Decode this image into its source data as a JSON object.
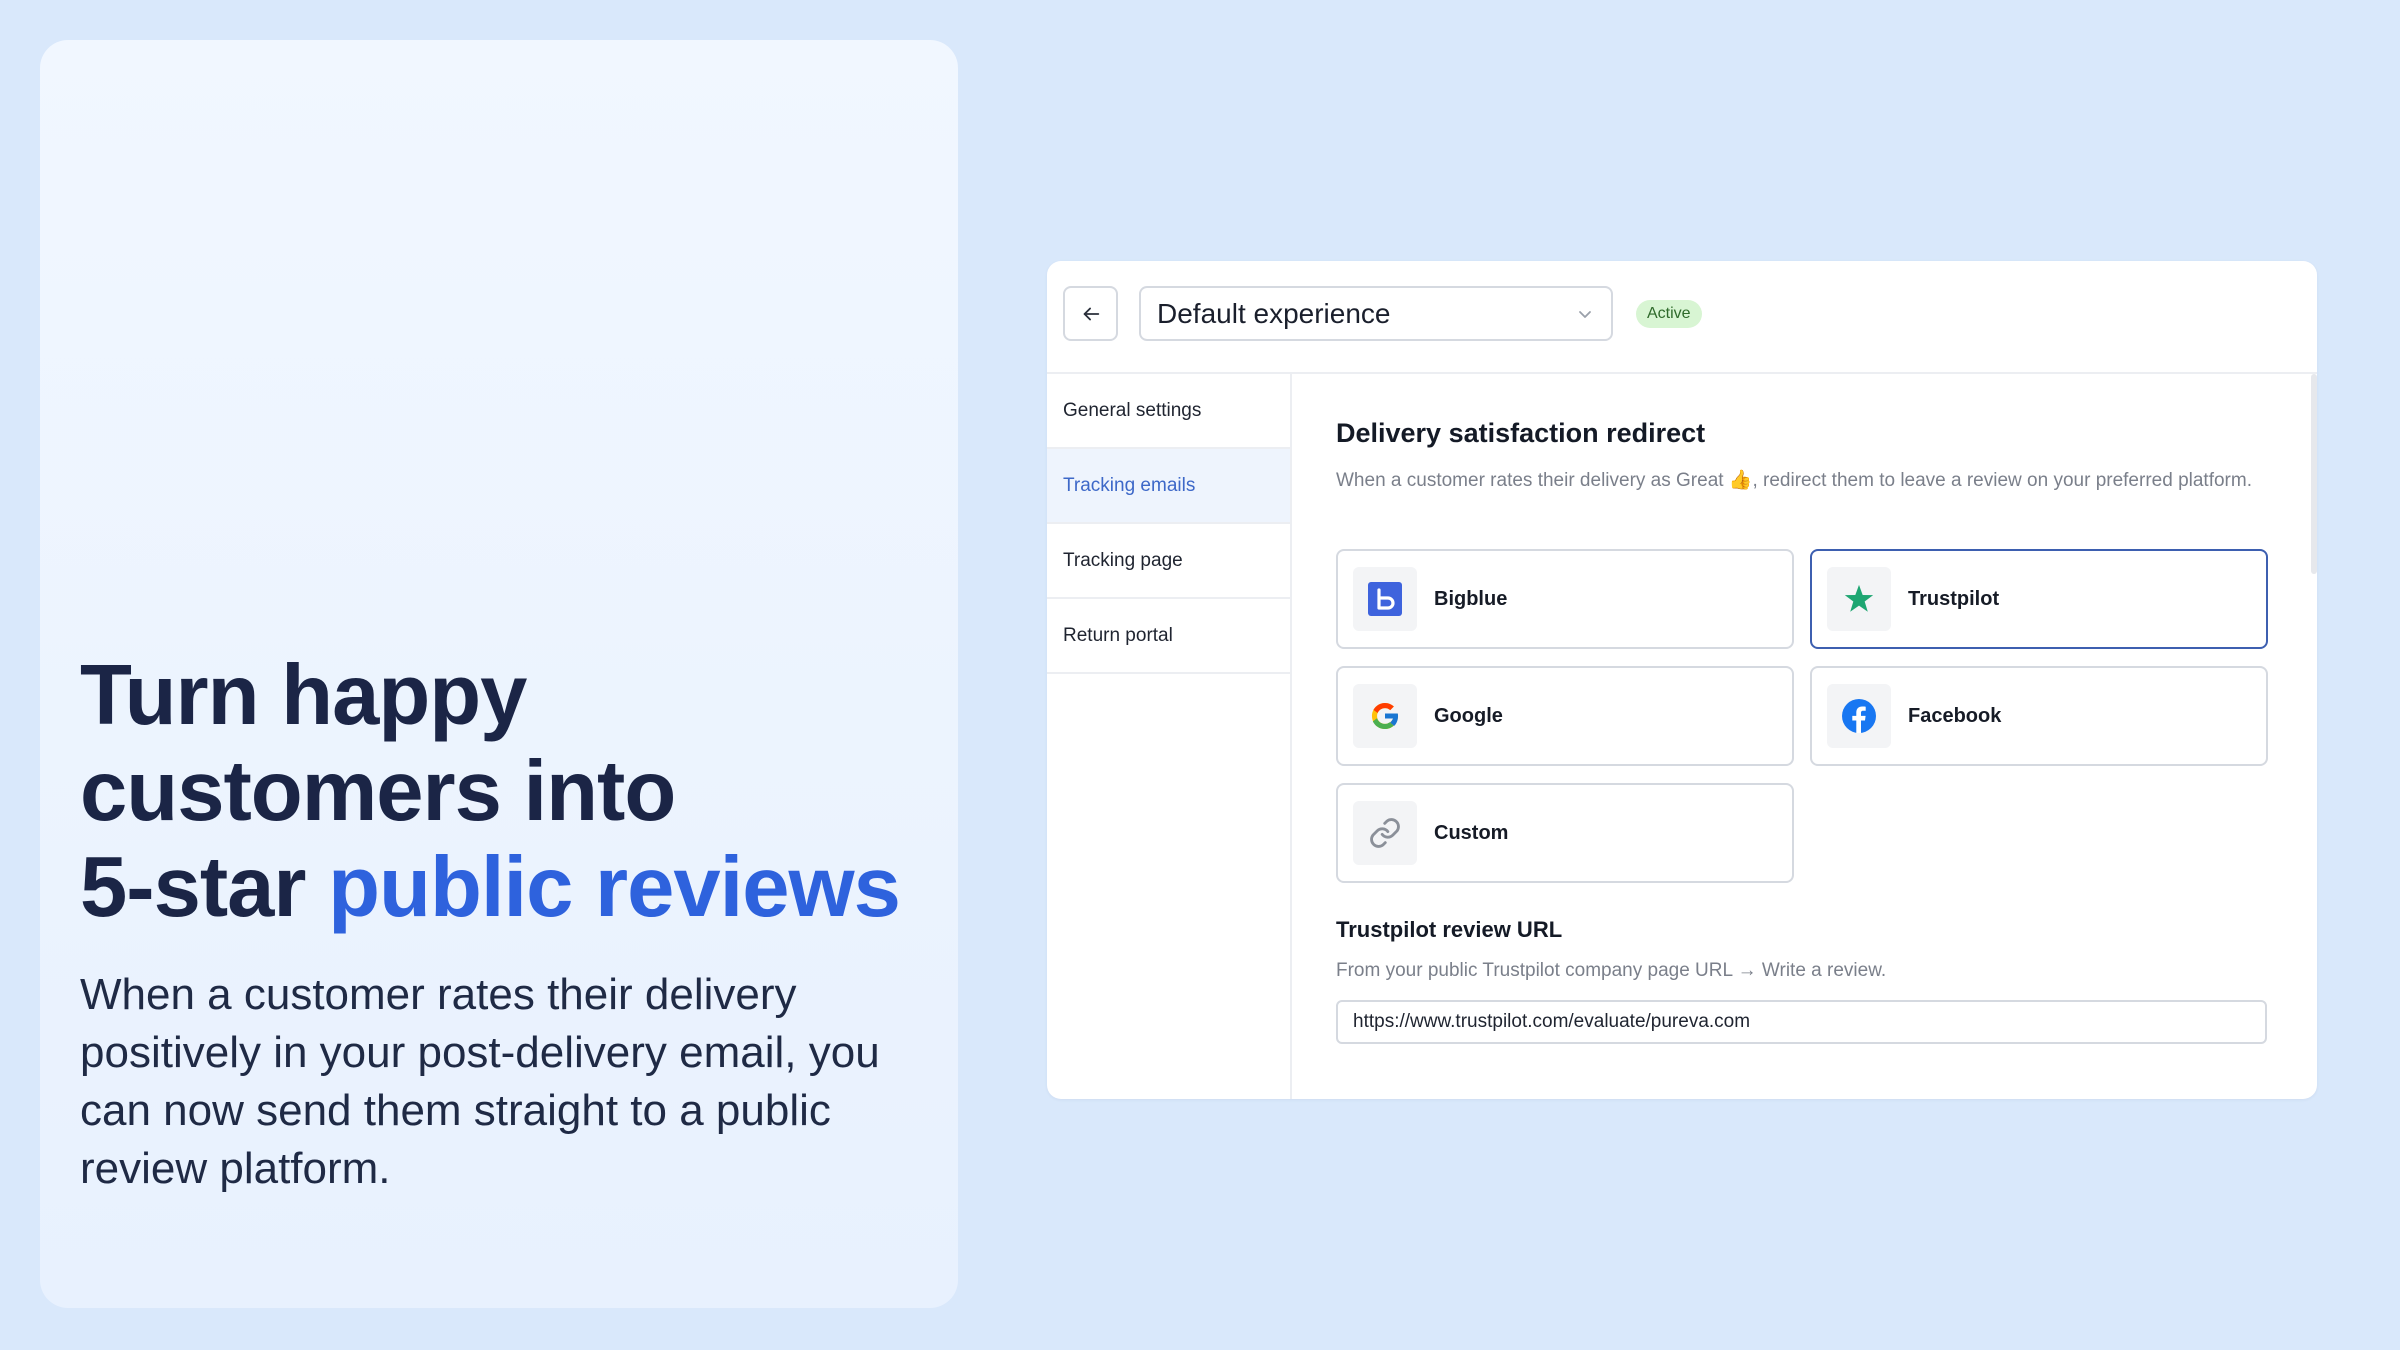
{
  "promo": {
    "headline_line1": "Turn happy",
    "headline_line2": "customers into",
    "headline_line3_prefix": "5-star ",
    "headline_line3_accent": "public reviews",
    "subtext": "When a customer rates their delivery positively in your post-delivery email, you can now send them straight to a public review platform."
  },
  "app": {
    "experience_value": "Default experience",
    "status_badge": "Active",
    "sidebar": {
      "items": [
        {
          "label": "General settings"
        },
        {
          "label": "Tracking emails"
        },
        {
          "label": "Tracking page"
        },
        {
          "label": "Return portal"
        }
      ]
    },
    "section": {
      "title": "Delivery satisfaction redirect",
      "description": "When a customer rates their delivery as Great 👍, redirect them to leave a review on your preferred platform."
    },
    "platforms": [
      {
        "label": "Bigblue",
        "icon": "bigblue-logo-icon"
      },
      {
        "label": "Trustpilot",
        "icon": "trustpilot-star-icon"
      },
      {
        "label": "Google",
        "icon": "google-logo-icon"
      },
      {
        "label": "Facebook",
        "icon": "facebook-logo-icon"
      },
      {
        "label": "Custom",
        "icon": "link-icon"
      }
    ],
    "selected_platform": "Trustpilot",
    "review_url": {
      "title": "Trustpilot review URL",
      "hint": "From your public Trustpilot company page URL → Write a review.",
      "value": "https://www.trustpilot.com/evaluate/pureva.com"
    }
  },
  "colors": {
    "background": "#d9e8fb",
    "accent": "#2e62dd",
    "headline": "#1b2546",
    "active_badge": "#d8f5d3",
    "selected_border": "#3d5fb0"
  }
}
